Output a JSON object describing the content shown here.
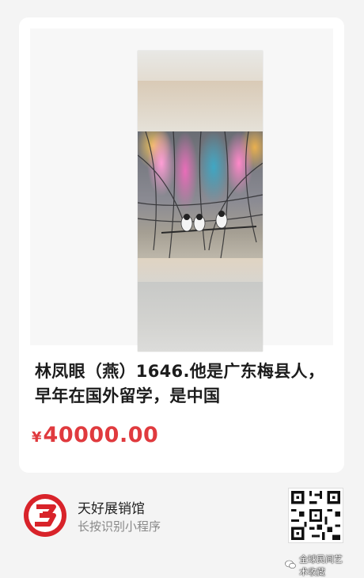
{
  "card": {
    "title": "林凤眼（燕）1646.他是广东梅县人，早年在国外留学，是中国",
    "price_currency": "¥",
    "price_amount": "40000.00"
  },
  "mini_program": {
    "name": "天好展销馆",
    "hint": "长按识别小程序",
    "logo_icon": "red-3-logo-icon",
    "qr_icon": "qr-code-icon"
  },
  "watermark": {
    "text": "全球民间艺术收藏"
  },
  "colors": {
    "price": "#e03a3e",
    "logo_red": "#d8232a"
  }
}
